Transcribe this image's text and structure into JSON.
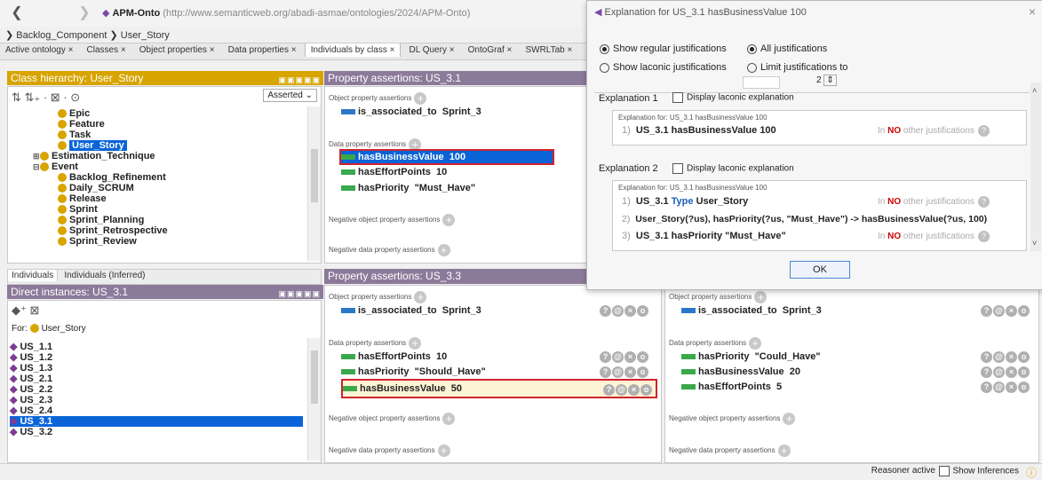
{
  "app": {
    "name": "APM-Onto",
    "url": "(http://www.semanticweb.org/abadi-asmae/ontologies/2024/APM-Onto)",
    "breadcrumb": [
      "Backlog_Component",
      "User_Story"
    ]
  },
  "tabs": [
    "Active ontology",
    "Classes",
    "Object properties",
    "Data properties",
    "Individuals by class",
    "DL Query",
    "OntoGraf",
    "SWRLTab"
  ],
  "active_tab": "Individuals by class",
  "class_hierarchy": {
    "title": "Class hierarchy: User_Story",
    "mode": "Asserted",
    "items": [
      {
        "label": "Epic",
        "indent": 2,
        "expander": ""
      },
      {
        "label": "Feature",
        "indent": 2,
        "expander": ""
      },
      {
        "label": "Task",
        "indent": 2,
        "expander": ""
      },
      {
        "label": "User_Story",
        "indent": 2,
        "expander": "",
        "selected": true
      },
      {
        "label": "Estimation_Technique",
        "indent": 1,
        "expander": "⊞"
      },
      {
        "label": "Event",
        "indent": 1,
        "expander": "⊟"
      },
      {
        "label": "Backlog_Refinement",
        "indent": 2,
        "expander": ""
      },
      {
        "label": "Daily_SCRUM",
        "indent": 2,
        "expander": ""
      },
      {
        "label": "Release",
        "indent": 2,
        "expander": ""
      },
      {
        "label": "Sprint",
        "indent": 2,
        "expander": ""
      },
      {
        "label": "Sprint_Planning",
        "indent": 2,
        "expander": ""
      },
      {
        "label": "Sprint_Retrospective",
        "indent": 2,
        "expander": ""
      },
      {
        "label": "Sprint_Review",
        "indent": 2,
        "expander": ""
      }
    ]
  },
  "individual_tabs": [
    "Individuals",
    "Individuals (Inferred)"
  ],
  "direct_instances": {
    "title": "Direct instances: US_3.1",
    "for_label": "For:",
    "for_class": "User_Story",
    "items": [
      "US_1.1",
      "US_1.2",
      "US_1.3",
      "US_2.1",
      "US_2.2",
      "US_2.3",
      "US_2.4",
      "US_3.1",
      "US_3.2"
    ],
    "selected": "US_3.1"
  },
  "labels": {
    "object_property_assertions": "Object property assertions",
    "data_property_assertions": "Data property assertions",
    "negative_object_property_assertions": "Negative object property assertions",
    "negative_data_property_assertions": "Negative data property assertions"
  },
  "pa_us31": {
    "title": "Property assertions: US_3.1",
    "object": [
      {
        "prop": "is_associated_to",
        "value": "Sprint_3"
      }
    ],
    "data": [
      {
        "prop": "hasBusinessValue",
        "value": "100",
        "selected": true
      },
      {
        "prop": "hasEffortPoints",
        "value": "10"
      },
      {
        "prop": "hasPriority",
        "value": "\"Must_Have\""
      }
    ]
  },
  "pa_us33": {
    "title": "Property assertions: US_3.3",
    "object": [
      {
        "prop": "is_associated_to",
        "value": "Sprint_3"
      }
    ],
    "data": [
      {
        "prop": "hasEffortPoints",
        "value": "10"
      },
      {
        "prop": "hasPriority",
        "value": "\"Should_Have\""
      },
      {
        "prop": "hasBusinessValue",
        "value": "50",
        "highlight": true
      }
    ]
  },
  "pa_right": {
    "object": [
      {
        "prop": "is_associated_to",
        "value": "Sprint_3"
      }
    ],
    "data": [
      {
        "prop": "hasPriority",
        "value": "\"Could_Have\""
      },
      {
        "prop": "hasBusinessValue",
        "value": "20"
      },
      {
        "prop": "hasEffortPoints",
        "value": "5"
      }
    ]
  },
  "dialog": {
    "title": "Explanation for US_3.1 hasBusinessValue 100",
    "opt_regular": "Show regular justifications",
    "opt_laconic": "Show laconic justifications",
    "opt_all": "All justifications",
    "opt_limit": "Limit justifications to",
    "limit_value": "2",
    "display_laconic": "Display laconic explanation",
    "explanation1": {
      "heading": "Explanation 1",
      "for": "Explanation for: US_3.1 hasBusinessValue 100",
      "lines": [
        {
          "num": "1)",
          "text": "US_3.1 hasBusinessValue 100",
          "note_pre": "In ",
          "note_no": "NO",
          "note_post": " other justifications"
        }
      ]
    },
    "explanation2": {
      "heading": "Explanation 2",
      "for": "Explanation for: US_3.1 hasBusinessValue 100",
      "lines": [
        {
          "num": "1)",
          "text_a": "US_3.1 ",
          "text_type": "Type",
          "text_b": " User_Story",
          "note_pre": "In ",
          "note_no": "NO",
          "note_post": " other justifications"
        },
        {
          "num": "2)",
          "text": "User_Story(?us), hasPriority(?us, \"Must_Have\") -> hasBusinessValue(?us, 100)"
        },
        {
          "num": "3)",
          "text": "US_3.1 hasPriority \"Must_Have\"",
          "note_pre": "In ",
          "note_no": "NO",
          "note_post": " other justifications"
        }
      ]
    },
    "ok": "OK"
  },
  "status": {
    "reasoner": "Reasoner active",
    "show_inferences": "Show Inferences"
  }
}
